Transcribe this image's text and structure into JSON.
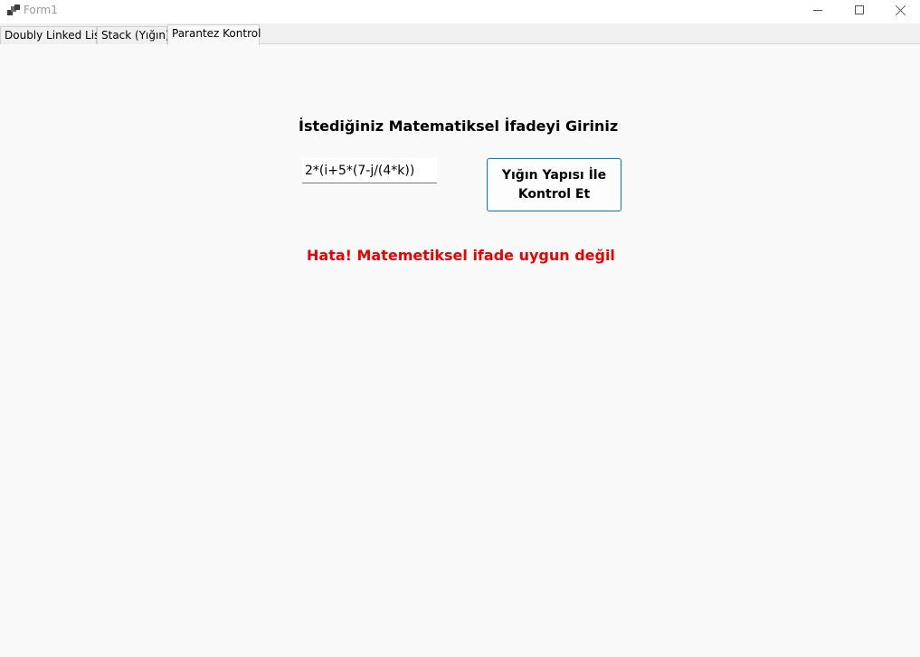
{
  "window": {
    "title": "Form1",
    "icons": {
      "app": "app-icon",
      "minimize": "minimize-icon",
      "maximize": "maximize-icon",
      "close": "close-icon"
    }
  },
  "tabs": [
    {
      "label": "Doubly Linked List",
      "active": false
    },
    {
      "label": "Stack (Yığın)",
      "active": false
    },
    {
      "label": "Parantez Kontrol",
      "active": true
    }
  ],
  "main": {
    "heading": "İstediğiniz Matematiksel İfadeyi Giriniz",
    "expression_value": "2*(i+5*(7-j/(4*k))",
    "check_button_label": "Yığın Yapısı İle Kontrol Et",
    "error_message": "Hata! Matemetiksel ifade uygun değil"
  },
  "colors": {
    "error": "#ee0000",
    "button_border": "#0078d4",
    "background": "#f9f9f9"
  }
}
